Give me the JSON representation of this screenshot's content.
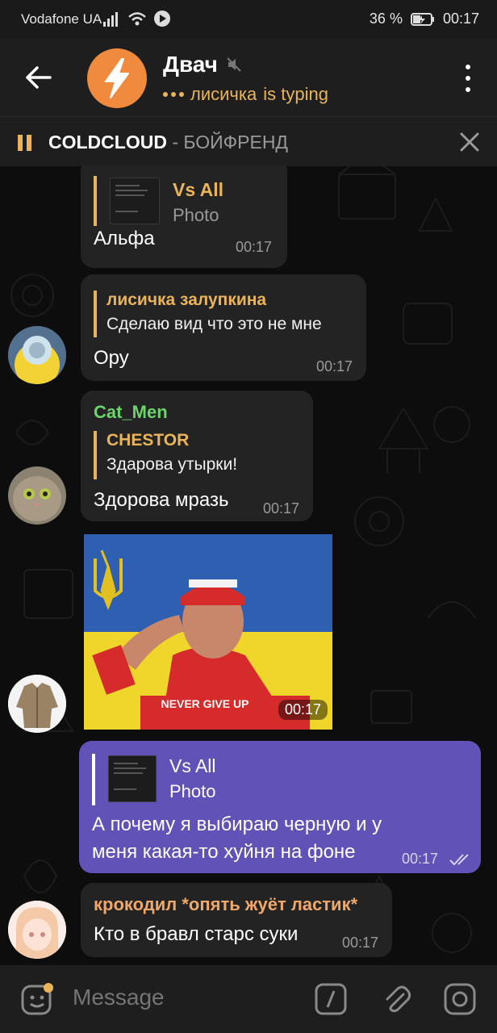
{
  "status_bar": {
    "carrier": "Vodafone UA",
    "battery": "36 %",
    "time": "00:17"
  },
  "header": {
    "title": "Двач",
    "typing_user": "лисичка",
    "typing_suffix": "is typing"
  },
  "player": {
    "artist": "COLDCLOUD",
    "separator": " - ",
    "track": "БОЙФРЕНД"
  },
  "messages": [
    {
      "reply_name": "Vs All",
      "reply_text": "Photo",
      "text": "Альфа",
      "time": "00:17"
    },
    {
      "reply_name": "лисичка залупкина",
      "reply_text": "Сделаю вид что это не мне",
      "text": "Ору",
      "time": "00:17"
    },
    {
      "sender": "Cat_Men",
      "reply_name": "CHESTOR",
      "reply_text": "Здарова утырки!",
      "text": "Здорова мразь",
      "time": "00:17"
    },
    {
      "photo": true,
      "time": "00:17"
    },
    {
      "reply_name": "Vs All",
      "reply_text": "Photo",
      "text_line1": "А почему я выбираю черную и у",
      "text_line2": "меня какая-то хуйня на фоне",
      "time": "00:17"
    },
    {
      "sender": "крокодил *опять жуёт ластик*",
      "text": "Кто в бравл старс суки",
      "time": "00:17"
    }
  ],
  "input": {
    "placeholder": "Message"
  },
  "colors": {
    "accent": "#e9b45a",
    "outgoing": "#6052b6",
    "incoming": "#232323",
    "green_name": "#6bd46b",
    "orange_name": "#f0a86a"
  }
}
